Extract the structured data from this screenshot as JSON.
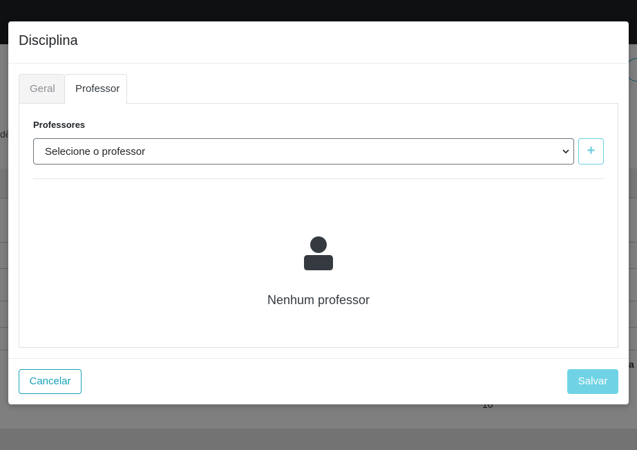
{
  "modal": {
    "title": "Disciplina",
    "tabs": [
      {
        "label": "Geral",
        "active": false
      },
      {
        "label": "Professor",
        "active": true
      }
    ],
    "professores": {
      "label": "Professores",
      "select_value": "Selecione o professor",
      "add_button": "+"
    },
    "empty_state": {
      "icon": "user-icon",
      "text": "Nenhum professor"
    },
    "footer": {
      "cancel_label": "Cancelar",
      "save_label": "Salvar"
    }
  },
  "background": {
    "fragment_left": "dê",
    "fragment_right": "a",
    "fragment_dash": "-",
    "fragment_number": "10"
  },
  "colors": {
    "accent": "#17a2b8",
    "save_disabled": "#6fd3e5",
    "topbar": "#1d2024"
  }
}
